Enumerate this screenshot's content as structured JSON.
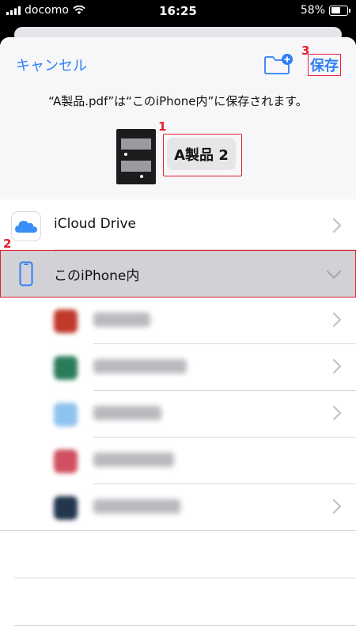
{
  "status": {
    "carrier": "docomo",
    "time": "16:25",
    "battery": "58%"
  },
  "header": {
    "cancel_label": "キャンセル",
    "save_label": "保存"
  },
  "message": "“A製品.pdf”は“このiPhone内”に保存されます。",
  "filename": "A製品 2",
  "markers": [
    "1",
    "2",
    "3"
  ],
  "locations": [
    {
      "label": "iCloud Drive",
      "icon": "icloud-icon"
    },
    {
      "label": "このiPhone内",
      "icon": "iphone-icon",
      "selected": true,
      "expanded": true
    }
  ],
  "subfolders": [
    {
      "label": "Acrobat",
      "icon_color": "#c0392b",
      "has_chevron": true
    },
    {
      "label": "CamScanner",
      "icon_color": "#2a7d5a",
      "has_chevron": true
    },
    {
      "label": "iLovePDF",
      "icon_color": "#8fc3ef",
      "has_chevron": true
    },
    {
      "label": "PDF Expert",
      "icon_color": "#d05060",
      "has_chevron": false
    },
    {
      "label": "PS Express",
      "icon_color": "#23364e",
      "has_chevron": true
    }
  ],
  "colors": {
    "accent": "#2f7ff6",
    "annotation": "#e0202a"
  }
}
